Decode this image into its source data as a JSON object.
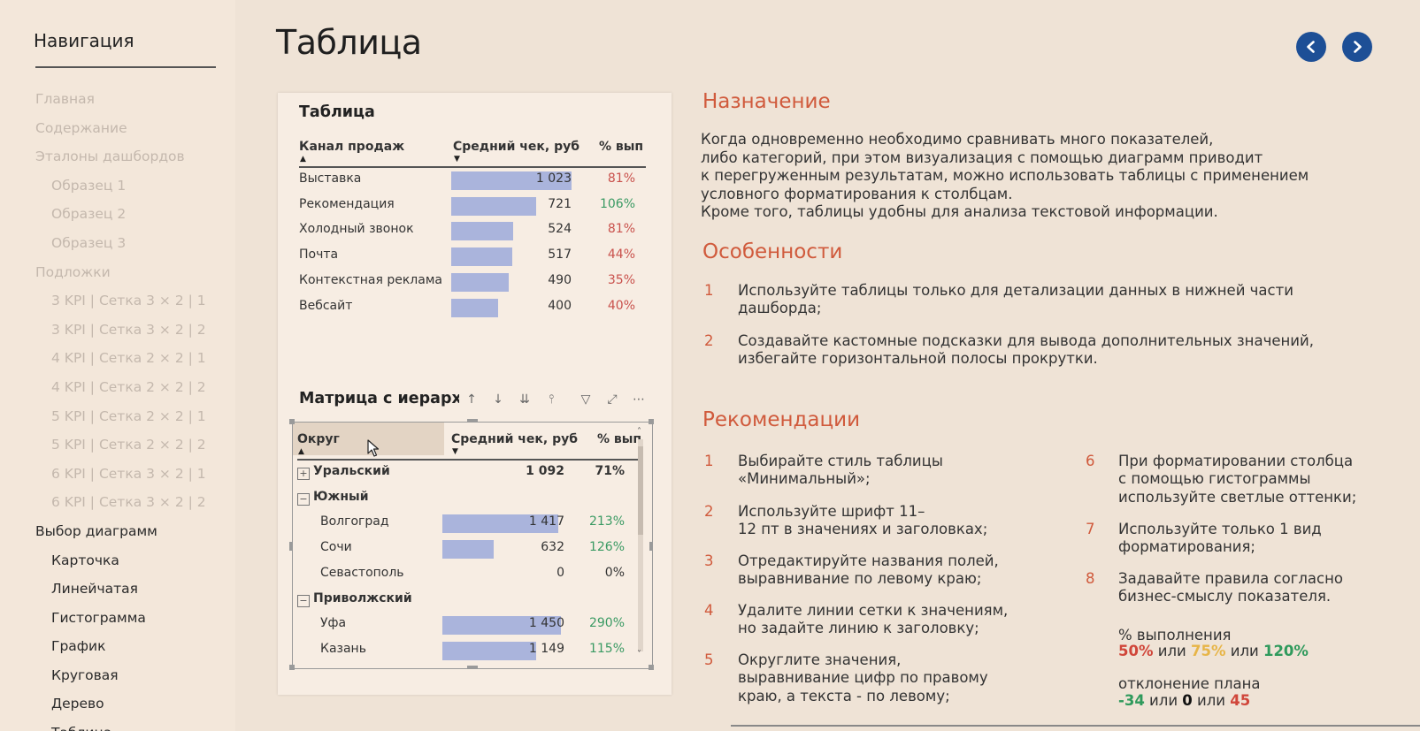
{
  "sidebar": {
    "title": "Навигация",
    "items": [
      {
        "label": "Главная"
      },
      {
        "label": "Содержание"
      },
      {
        "label": "Эталоны дашбордов"
      },
      {
        "label": "Образец 1"
      },
      {
        "label": "Образец 2"
      },
      {
        "label": "Образец 3"
      },
      {
        "label": "Подложки"
      },
      {
        "label": "3 KPI | Сетка 3 × 2 | 1"
      },
      {
        "label": "3 KPI | Сетка 3 × 2 | 2"
      },
      {
        "label": "4 KPI | Сетка 2 × 2 | 1"
      },
      {
        "label": "4 KPI | Сетка 2 × 2 | 2"
      },
      {
        "label": "5 KPI | Сетка 2 × 2 | 1"
      },
      {
        "label": "5 KPI | Сетка 2 × 2 | 2"
      },
      {
        "label": "6 KPI | Сетка 3 × 2 | 1"
      },
      {
        "label": "6 KPI | Сетка 3 × 2 | 2"
      },
      {
        "label": "Выбор диаграмм"
      },
      {
        "label": "Карточка"
      },
      {
        "label": "Линейчатая"
      },
      {
        "label": "Гистограмма"
      },
      {
        "label": "График"
      },
      {
        "label": "Круговая"
      },
      {
        "label": "Дерево"
      },
      {
        "label": "Таблица"
      }
    ]
  },
  "header": {
    "title": "Таблица",
    "accent_color": "#1d4f96"
  },
  "table": {
    "title": "Таблица",
    "columns": [
      "Канал продаж",
      "Средний чек, руб",
      "% вып"
    ],
    "max_value": 1023,
    "rows": [
      {
        "label": "Выставка",
        "value": 1023,
        "value_text": "1 023",
        "pct": "81%",
        "status": "red"
      },
      {
        "label": "Рекомендация",
        "value": 721,
        "value_text": "721",
        "pct": "106%",
        "status": "green"
      },
      {
        "label": "Холодный звонок",
        "value": 524,
        "value_text": "524",
        "pct": "81%",
        "status": "red"
      },
      {
        "label": "Почта",
        "value": 517,
        "value_text": "517",
        "pct": "44%",
        "status": "red"
      },
      {
        "label": "Контекстная реклама",
        "value": 490,
        "value_text": "490",
        "pct": "35%",
        "status": "red"
      },
      {
        "label": "Вебсайт",
        "value": 400,
        "value_text": "400",
        "pct": "40%",
        "status": "red"
      }
    ]
  },
  "matrix": {
    "title": "Матрица с иерархи",
    "columns": [
      "Округ",
      "Средний чек, руб",
      "% вып"
    ],
    "max_value": 1450,
    "rows": [
      {
        "label": "Уральский",
        "level": 0,
        "expander": "+",
        "value": null,
        "value_text": "1 092",
        "pct": "71%",
        "status": "normal"
      },
      {
        "label": "Южный",
        "level": 0,
        "expander": "−",
        "value": null,
        "value_text": "",
        "pct": "",
        "status": "normal"
      },
      {
        "label": "Волгоград",
        "level": 1,
        "expander": "",
        "value": 1417,
        "value_text": "1 417",
        "pct": "213%",
        "status": "green"
      },
      {
        "label": "Сочи",
        "level": 1,
        "expander": "",
        "value": 632,
        "value_text": "632",
        "pct": "126%",
        "status": "green"
      },
      {
        "label": "Севастополь",
        "level": 1,
        "expander": "",
        "value": 0,
        "value_text": "0",
        "pct": "0%",
        "status": "normal"
      },
      {
        "label": "Приволжский",
        "level": 0,
        "expander": "−",
        "value": null,
        "value_text": "",
        "pct": "",
        "status": "normal"
      },
      {
        "label": "Уфа",
        "level": 1,
        "expander": "",
        "value": 1450,
        "value_text": "1 450",
        "pct": "290%",
        "status": "green"
      },
      {
        "label": "Казань",
        "level": 1,
        "expander": "",
        "value": 1149,
        "value_text": "1 149",
        "pct": "115%",
        "status": "green"
      }
    ]
  },
  "toolbar": [
    "arrow-up-icon",
    "arrow-down-icon",
    "double-down-icon",
    "expand-hierarchy-icon",
    "filter-icon",
    "focus-mode-icon",
    "more-options-icon"
  ],
  "purpose": {
    "heading": "Назначение",
    "text": "Когда одновременно необходимо сравнивать много показателей,\nлибо категорий, при этом визуализация с помощью диаграмм приводит\nк перегруженным результатам, можно использовать таблицы с применением\nусловного форматирования к столбцам.\nКроме того, таблицы удобны для анализа текстовой информации."
  },
  "features": {
    "heading": "Особенности",
    "items": [
      {
        "num": "1",
        "text": "Используйте таблицы только для детализации данных в нижней части\nдашборда;"
      },
      {
        "num": "2",
        "text": "Создавайте кастомные подсказки для вывода дополнительных значений,\nизбегайте горизонтальной полосы прокрутки."
      }
    ]
  },
  "recommendations": {
    "heading": "Рекомендации",
    "left": [
      {
        "num": "1",
        "text": "Выбирайте стиль таблицы\n«Минимальный»;"
      },
      {
        "num": "2",
        "text": "Используйте шрифт 11–\n12 пт в значениях и заголовках;"
      },
      {
        "num": "3",
        "text": "Отредактируйте названия полей,\nвыравнивание по левому краю;"
      },
      {
        "num": "4",
        "text": "Удалите линии сетки к значениям,\nно задайте линию к заголовку;"
      },
      {
        "num": "5",
        "text": "Округлите значения,\nвыравнивание цифр по правому\nкраю, а текста - по левому;"
      }
    ],
    "right": [
      {
        "num": "6",
        "text": "При форматировании столбца\nс помощью гистограммы\nиспользуйте светлые оттенки;"
      },
      {
        "num": "7",
        "text": "Используйте только 1 вид\nформатирования;"
      },
      {
        "num": "8",
        "text": "Задавайте правила согласно\nбизнес-смыслу показателя."
      }
    ],
    "completion_label": "% выполнения",
    "completion_values": [
      {
        "text": "50%",
        "color": "#d0463a"
      },
      {
        "text": " или ",
        "color": "#333333"
      },
      {
        "text": "75%",
        "color": "#e7b548"
      },
      {
        "text": " или ",
        "color": "#333333"
      },
      {
        "text": "120%",
        "color": "#2f9a5c"
      }
    ],
    "deviation_label": "отклонение плана",
    "deviation_values": [
      {
        "text": "-34",
        "color": "#2f9a5c"
      },
      {
        "text": " или ",
        "color": "#333333"
      },
      {
        "text": "0",
        "color": "#111111"
      },
      {
        "text": " или ",
        "color": "#333333"
      },
      {
        "text": "45",
        "color": "#d0463a"
      }
    ]
  }
}
